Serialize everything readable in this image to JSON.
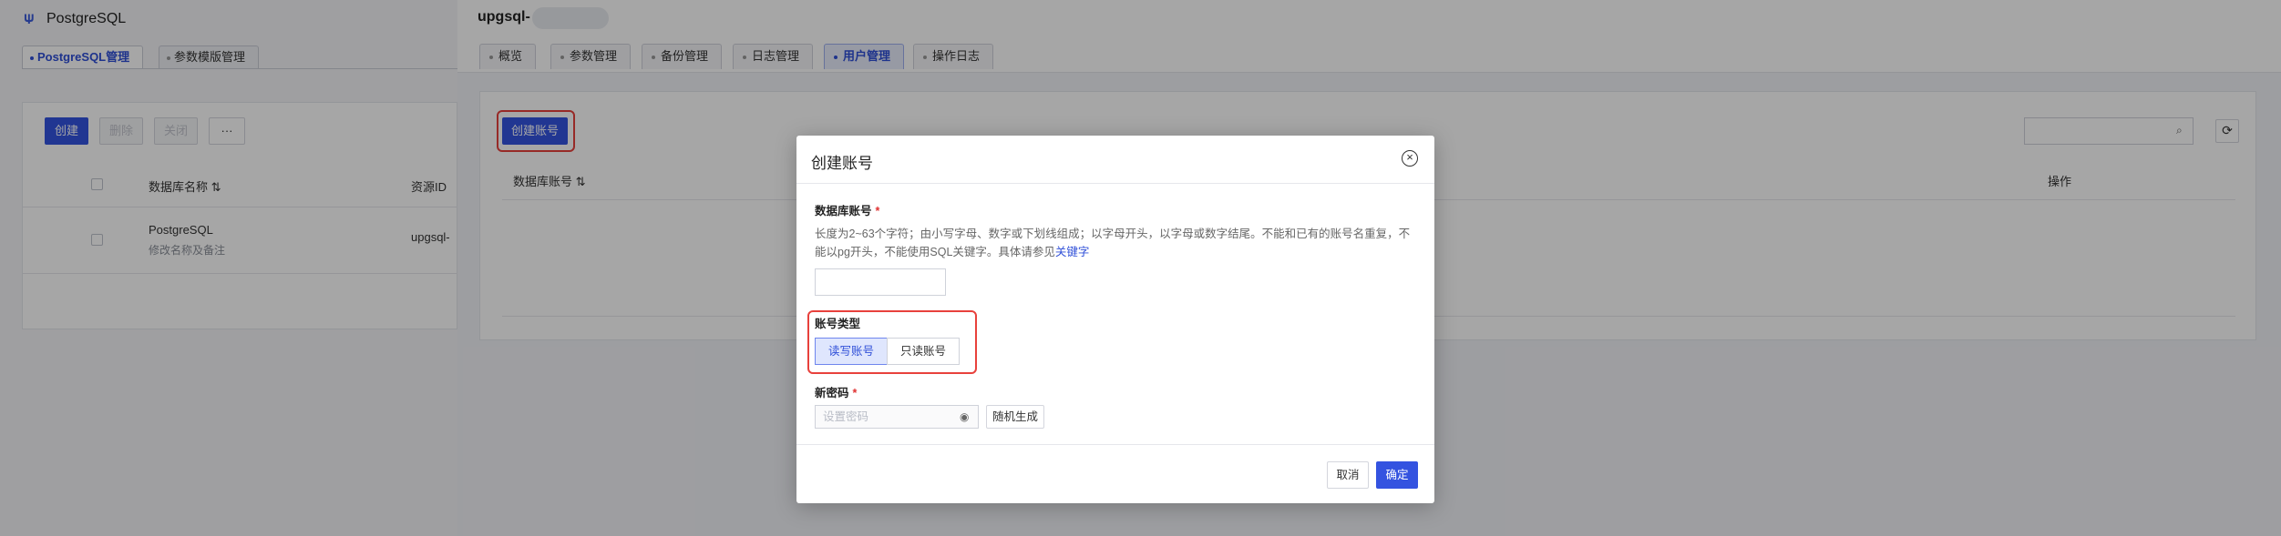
{
  "left": {
    "app_title": "PostgreSQL",
    "tabs": [
      {
        "label": "PostgreSQL管理"
      },
      {
        "label": "参数模版管理"
      }
    ],
    "toolbar": {
      "create": "创建",
      "delete": "删除",
      "close": "关闭",
      "more": "···"
    },
    "table": {
      "col_name": "数据库名称",
      "sort_icon": "⇅",
      "col_resource": "资源ID"
    },
    "row": {
      "name": "PostgreSQL",
      "note": "修改名称及备注",
      "resource": "upgsql-"
    }
  },
  "main": {
    "instance_title": "upgsql-",
    "tabs": [
      {
        "label": "概览"
      },
      {
        "label": "参数管理"
      },
      {
        "label": "备份管理"
      },
      {
        "label": "日志管理"
      },
      {
        "label": "用户管理"
      },
      {
        "label": "操作日志"
      }
    ],
    "create_account_button": "创建账号",
    "table": {
      "col_account": "数据库账号",
      "sort_icon": "⇅",
      "col_ops": "操作"
    },
    "search_placeholder": "",
    "icons": {
      "search": "search-icon",
      "refresh": "refresh-icon"
    }
  },
  "dialog": {
    "title": "创建账号",
    "account_label": "数据库账号",
    "required_mark": "*",
    "hint_text": "长度为2~63个字符；由小写字母、数字或下划线组成；以字母开头，以字母或数字结尾。不能和已有的账号名重复，不能以pg开头，不能使用SQL关键字。具体请参见",
    "hint_link": "关键字",
    "account_value": "",
    "type_label": "账号类型",
    "type_options": [
      {
        "label": "读写账号",
        "selected": true
      },
      {
        "label": "只读账号",
        "selected": false
      }
    ],
    "password_label": "新密码",
    "password_placeholder": "设置密码",
    "random_button": "随机生成",
    "cancel_button": "取消",
    "confirm_button": "确定"
  },
  "colors": {
    "primary": "#3453e0",
    "highlight": "#e8413c",
    "overlay": "rgba(0,0,0,0.35)"
  }
}
